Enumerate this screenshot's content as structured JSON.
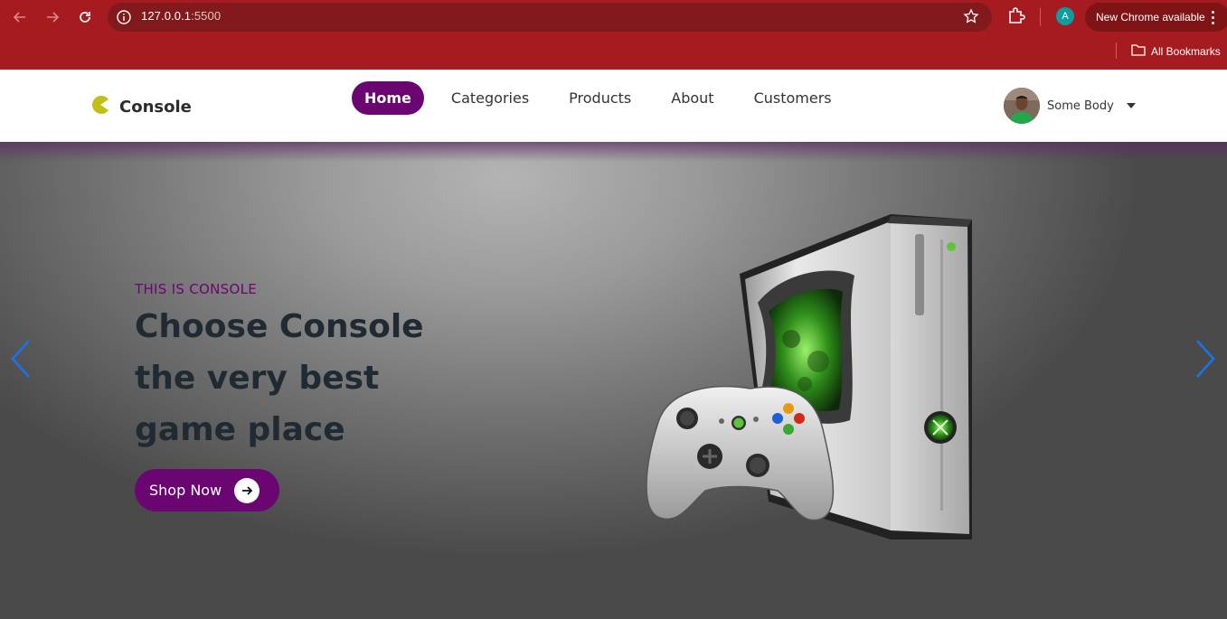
{
  "browser": {
    "url_host": "127.0.0.1",
    "url_port": ":5500",
    "profile_initial": "A",
    "update_label": "New Chrome available",
    "bookmarks_label": "All Bookmarks",
    "icons": [
      "back-icon",
      "forward-icon",
      "reload-icon",
      "info-icon",
      "star-icon",
      "extensions-icon",
      "more-icon",
      "folder-icon"
    ]
  },
  "site": {
    "logo_text": "Console",
    "nav": [
      {
        "label": "Home",
        "active": true
      },
      {
        "label": "Categories",
        "active": false
      },
      {
        "label": "Products",
        "active": false
      },
      {
        "label": "About",
        "active": false
      },
      {
        "label": "Customers",
        "active": false
      }
    ],
    "user_name": "Some Body",
    "accent": "#6b0572"
  },
  "hero": {
    "eyebrow": "THIS IS CONSOLE",
    "headline": "Choose Console the very best game place",
    "cta": "Shop Now",
    "headline_color": "#1f2a33",
    "arrow_color": "#1a73e8"
  }
}
